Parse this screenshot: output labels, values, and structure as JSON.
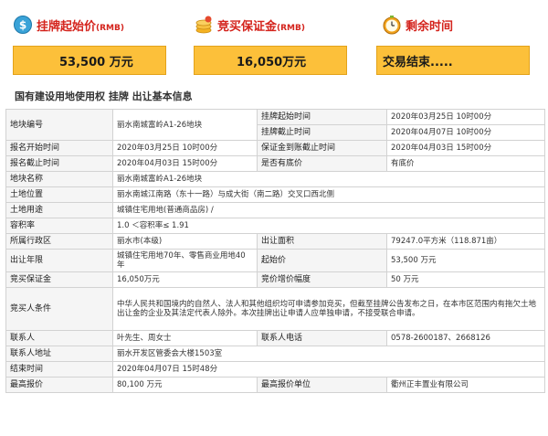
{
  "summary": {
    "start_price": {
      "label": "挂牌起始价",
      "unit": "(RMB)",
      "value": "53,500 万元"
    },
    "deposit": {
      "label": "竞买保证金",
      "unit": "(RMB)",
      "value": "16,050万元"
    },
    "remaining": {
      "label": "剩余时间",
      "value": "交易结束....."
    }
  },
  "section_title": "国有建设用地使用权 挂牌 出让基本信息",
  "rows": {
    "parcel_no": {
      "k": "地块编号",
      "v": "丽水南城富岭A1-26地块"
    },
    "list_start": {
      "k": "挂牌起始时间",
      "v": "2020年03月25日 10时00分"
    },
    "list_end": {
      "k": "挂牌截止时间",
      "v": "2020年04月07日 10时00分"
    },
    "reg_start": {
      "k": "报名开始时间",
      "v": "2020年03月25日 10时00分"
    },
    "deposit_deadline": {
      "k": "保证金到账截止时间",
      "v": "2020年04月03日 15时00分"
    },
    "reg_end": {
      "k": "报名截止时间",
      "v": "2020年04月03日 15时00分"
    },
    "reserve": {
      "k": "是否有底价",
      "v": "有底价"
    },
    "parcel_name": {
      "k": "地块名称",
      "v": "丽水南城富岭A1-26地块"
    },
    "location": {
      "k": "土地位置",
      "v": "丽水南城江南路（东十一路）与成大街（南二路）交叉口西北侧"
    },
    "usage": {
      "k": "土地用途",
      "v": "城镇住宅用地(普通商品房) /"
    },
    "far": {
      "k": "容积率",
      "v": "1.0 ＜容积率≤ 1.91"
    },
    "district": {
      "k": "所属行政区",
      "v": "丽水市(本级)"
    },
    "area": {
      "k": "出让面积",
      "v": "79247.0平方米（118.871亩）"
    },
    "term": {
      "k": "出让年限",
      "v": "城镇住宅用地70年、零售商业用地40年"
    },
    "start_price": {
      "k": "起始价",
      "v": "53,500 万元"
    },
    "deposit": {
      "k": "竞买保证金",
      "v": "16,050万元"
    },
    "increment": {
      "k": "竞价增价幅度",
      "v": "50 万元"
    },
    "conditions": {
      "k": "竞买人条件",
      "v": "中华人民共和国境内的自然人、法人和其他组织均可申请参加竞买，但截至挂牌公告发布之日，在本市区范围内有拖欠土地出让金的企业及其法定代表人除外。本次挂牌出让申请人应单独申请，不接受联合申请。"
    },
    "contact": {
      "k": "联系人",
      "v": "叶先生、周女士"
    },
    "phone": {
      "k": "联系人电话",
      "v": "0578-2600187、2668126"
    },
    "address": {
      "k": "联系人地址",
      "v": "丽水开发区管委会大楼1503室"
    },
    "end_time": {
      "k": "结束时间",
      "v": "2020年04月07日 15时48分"
    },
    "max_bid": {
      "k": "最高报价",
      "v": "80,100 万元"
    },
    "max_bidder": {
      "k": "最高报价单位",
      "v": "衢州正丰置业有限公司"
    }
  },
  "colors": {
    "accent": "#d4231c",
    "box": "#fcc03a",
    "box_border": "#e3a21a",
    "key_bg": "#f5f5f5"
  },
  "icons": [
    "price-icon",
    "deposit-icon",
    "clock-icon"
  ]
}
